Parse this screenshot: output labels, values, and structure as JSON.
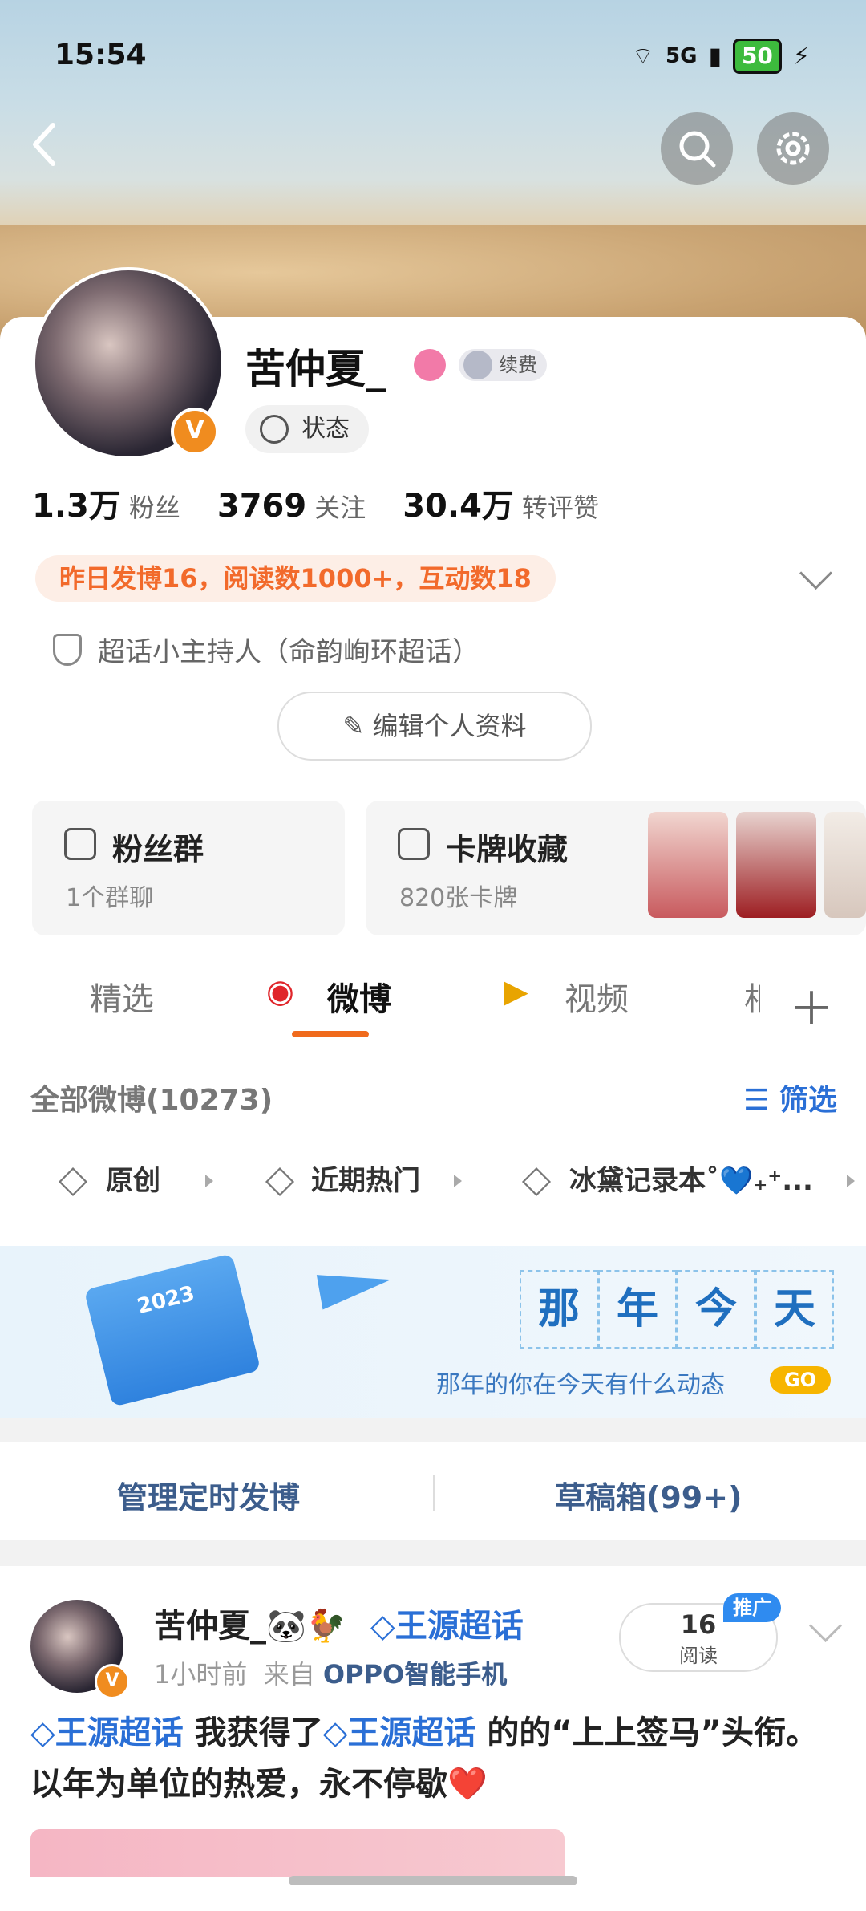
{
  "status_bar": {
    "time": "15:54",
    "network": "5G",
    "battery": "50"
  },
  "header": {
    "back_icon": "back-arrow-icon",
    "search_icon": "search-icon",
    "settings_icon": "gear-icon"
  },
  "profile": {
    "name": "苦仲夏_",
    "vip_label": "续费",
    "state_label": "状态",
    "stats": [
      {
        "num": "1.3万",
        "label": "粉丝"
      },
      {
        "num": "3769",
        "label": "关注"
      },
      {
        "num": "30.4万",
        "label": "转评赞"
      }
    ],
    "activity": "昨日发博16，阅读数1000+，互动数18",
    "host": "超话小主持人（命韵峋环超话）",
    "edit_button": "编辑个人资料",
    "badge": "V"
  },
  "tiles": {
    "fans": {
      "title": "粉丝群",
      "sub": "1个群聊"
    },
    "cards": {
      "title": "卡牌收藏",
      "sub": "820张卡牌"
    }
  },
  "tabs": [
    "精选",
    "微博",
    "视频",
    "相"
  ],
  "list": {
    "all": "全部微博(10273)",
    "filter": "筛选",
    "chips": [
      "原创",
      "近期热门",
      "冰黛记录本˚💙₊⁺..."
    ]
  },
  "promo": {
    "cells": [
      "那",
      "年",
      "今",
      "天"
    ],
    "sub": "那年的你在今天有什么动态",
    "go": "GO",
    "calendar_year": "2023"
  },
  "manage": {
    "scheduled": "管理定时发博",
    "drafts": "草稿箱(99+)"
  },
  "post": {
    "name": "苦仲夏_🐼🐓",
    "tag": "王源超话",
    "time": "1小时前",
    "from": "来自",
    "source": "OPPO智能手机",
    "reads": "16",
    "reads_label": "阅读",
    "promo_tag": "推广",
    "text_tag1": "王源超话",
    "text_mid": " 我获得了",
    "text_tag2": "王源超话",
    "text_end": " 的的“上上签马”头衔。以年为单位的热爱，永不停歇❤️"
  }
}
